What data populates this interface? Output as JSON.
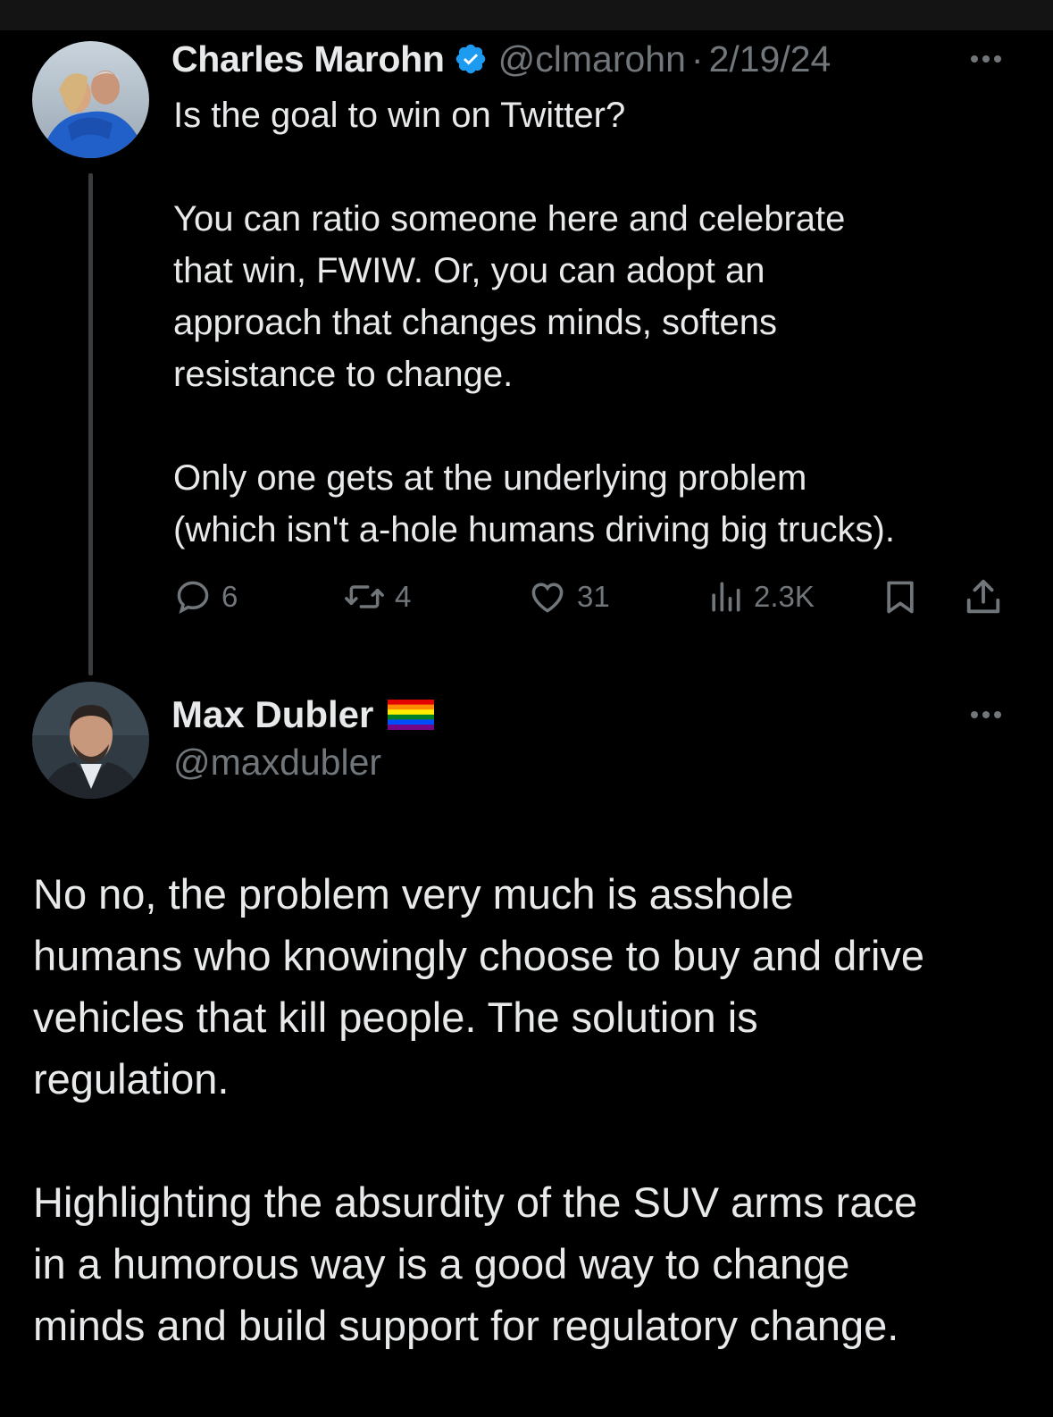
{
  "colors": {
    "background": "#000000",
    "text_primary": "#e7e9ea",
    "text_secondary": "#71767b",
    "verified_blue": "#1d9bf0",
    "thread_line": "#3a3d40"
  },
  "tweet": {
    "author_name": "Charles Marohn",
    "verified": true,
    "handle": "@clmarohn",
    "separator": "·",
    "date": "2/19/24",
    "paragraphs": [
      [
        "Is the goal to win on Twitter?"
      ],
      [
        "You can ratio someone here and celebrate",
        "that win, FWIW. Or, you can adopt an",
        "approach that changes minds, softens",
        "resistance to change."
      ],
      [
        "Only one gets at the underlying problem",
        "(which isn't a-hole humans driving big trucks)."
      ]
    ],
    "stats": {
      "replies": "6",
      "retweets": "4",
      "likes": "31",
      "views": "2.3K"
    },
    "icons": [
      "reply-icon",
      "retweet-icon",
      "like-icon",
      "views-icon",
      "bookmark-icon",
      "share-icon",
      "more-icon"
    ]
  },
  "reply": {
    "author_name": "Max Dubler",
    "badge": "rainbow-flag-icon",
    "handle": "@maxdubler",
    "paragraphs": [
      [
        "No no, the problem very much is asshole",
        "humans who knowingly choose to buy and drive",
        "vehicles that kill people. The solution is",
        "regulation."
      ],
      [
        "Highlighting the absurdity of the SUV arms race",
        "in a humorous way is a good way to change",
        "minds and build support for regulatory change."
      ]
    ]
  }
}
